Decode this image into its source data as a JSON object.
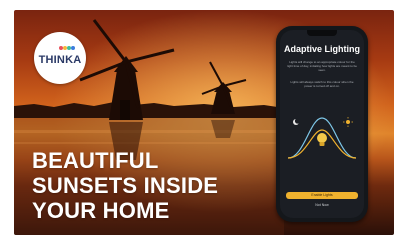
{
  "brand": {
    "name": "THINKA",
    "dot_colors": [
      "#e9505b",
      "#f6b73c",
      "#3fbf9a",
      "#3b7ddd"
    ]
  },
  "headline": {
    "lines": [
      "BEAUTIFUL",
      "SUNSETS INSIDE",
      "YOUR HOME"
    ]
  },
  "phone": {
    "title": "Adaptive Lighting",
    "description_1": "Lights will change to an appropriate colour for the right time of day, imitating how lights are meant to be seen.",
    "description_2": "Lights will always switch to this colour when the power is turned off and on.",
    "primary_button": "Enable Lights",
    "secondary_link": "Not Now",
    "accent_color": "#f0b22e"
  }
}
